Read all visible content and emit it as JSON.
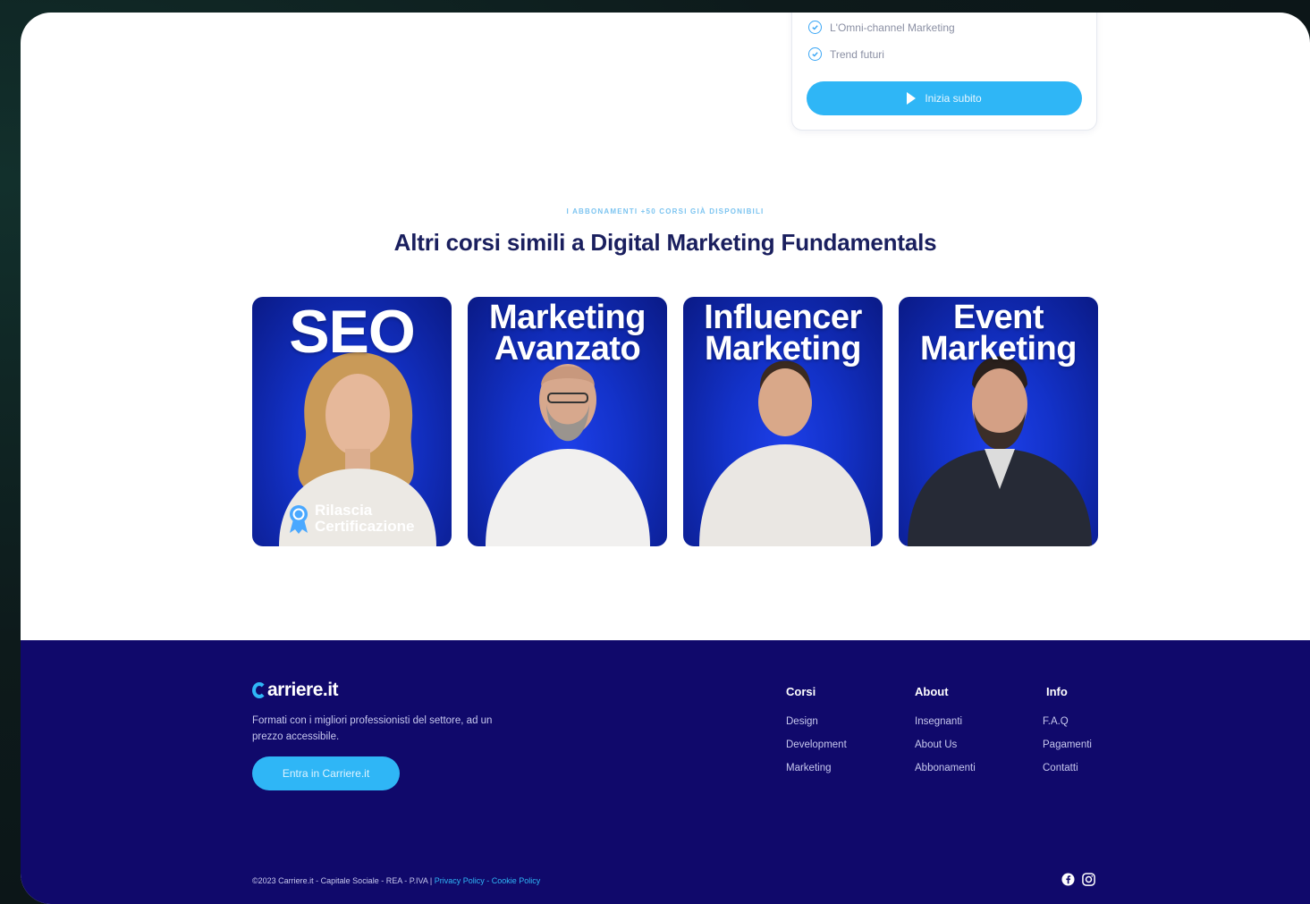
{
  "purchase_card": {
    "features": [
      "L'Omni-channel Marketing",
      "Trend futuri"
    ],
    "start_label": "Inizia subito"
  },
  "related": {
    "eyebrow": "I abbonamenti +50 corsi già disponibili",
    "title": "Altri corsi simili a Digital Marketing Fundamentals",
    "courses": [
      {
        "title_line1": "SEO",
        "title_line2": "",
        "badge": [
          "Rilascia",
          "Certificazione"
        ]
      },
      {
        "title_line1": "Marketing",
        "title_line2": "Avanzato"
      },
      {
        "title_line1": "Influencer",
        "title_line2": "Marketing"
      },
      {
        "title_line1": "Event",
        "title_line2": "Marketing"
      }
    ]
  },
  "footer": {
    "logo": "arriere.it",
    "tagline": "Formati con i migliori professionisti del settore, ad un prezzo accessibile.",
    "cta_label": "Entra in Carriere.it",
    "columns": [
      {
        "heading": "Corsi",
        "links": [
          "Design",
          "Development",
          "Marketing"
        ]
      },
      {
        "heading": "About",
        "links": [
          "Insegnanti",
          "About Us",
          "Abbonamenti"
        ]
      },
      {
        "heading": "Info",
        "links": [
          "F.A.Q",
          "Pagamenti",
          "Contatti"
        ]
      }
    ],
    "copyright": "©2023 Carriere.it - Capitale Sociale - REA - P.IVA | ",
    "privacy": "Privacy Policy",
    "separator": " - ",
    "cookie": "Cookie Policy"
  },
  "colors": {
    "accent": "#2fb6f6",
    "footer_bg": "#10096b",
    "title": "#1a1f5e",
    "card_blue": "#1332c9"
  },
  "icons": [
    "check-circle-icon",
    "play-icon",
    "certificate-badge-icon",
    "facebook-icon",
    "instagram-icon"
  ]
}
